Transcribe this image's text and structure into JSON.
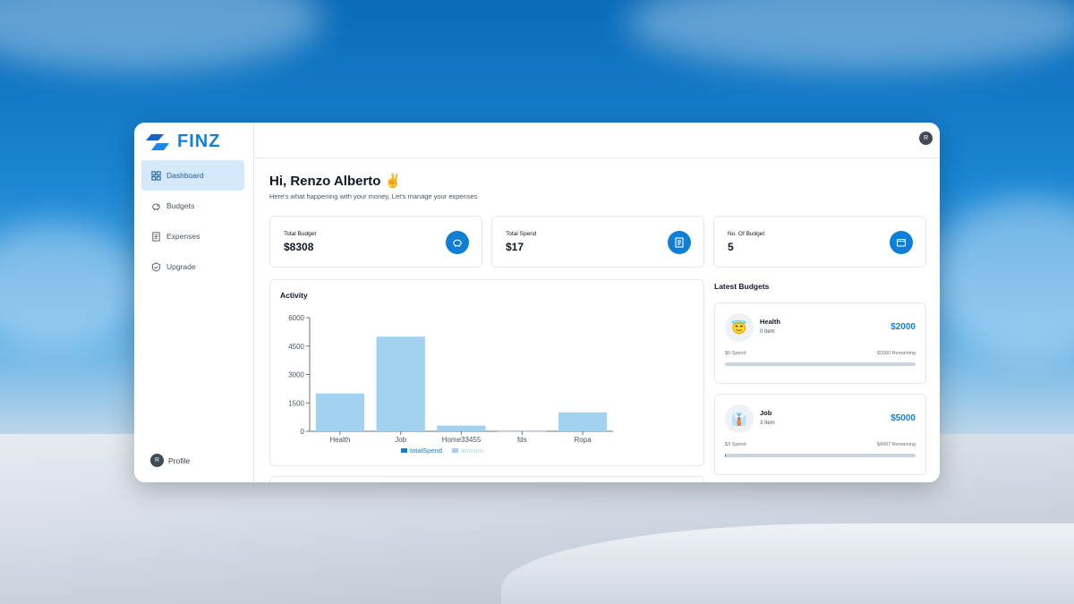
{
  "app": {
    "name": "FINZ"
  },
  "sidebar": {
    "items": [
      {
        "label": "Dashboard",
        "icon": "grid-icon",
        "active": true
      },
      {
        "label": "Budgets",
        "icon": "piggy-bank-icon",
        "active": false
      },
      {
        "label": "Expenses",
        "icon": "receipt-icon",
        "active": false
      },
      {
        "label": "Upgrade",
        "icon": "shield-check-icon",
        "active": false
      }
    ],
    "profile": {
      "initial": "R",
      "label": "Profile"
    }
  },
  "topbar": {
    "avatar_initial": "R"
  },
  "header": {
    "greeting": "Hi, Renzo Alberto ✌️",
    "subtitle": "Here's what happening with your money, Let's manage your expenses"
  },
  "cards": [
    {
      "label": "Total Budget",
      "value": "$8308",
      "icon": "piggy-bank-icon"
    },
    {
      "label": "Total Spend",
      "value": "$17",
      "icon": "receipt-icon"
    },
    {
      "label": "No. Of Budget",
      "value": "5",
      "icon": "wallet-icon"
    }
  ],
  "activity": {
    "title": "Activity"
  },
  "latest": {
    "title": "Latest Budgets",
    "budgets": [
      {
        "emoji": "😇",
        "name": "Health",
        "items": "0 Item",
        "amount": "$2000",
        "spend": "$0 Spend",
        "remaining": "$2000 Remaining",
        "progress": 0
      },
      {
        "emoji": "👔",
        "name": "Job",
        "items": "3 Item",
        "amount": "$5000",
        "spend": "$3 Spend",
        "remaining": "$4997 Remaining",
        "progress": 0.0006
      }
    ]
  },
  "colors": {
    "accent": "#0f7fd6",
    "bar_light": "#a3d2f0"
  },
  "chart_data": {
    "type": "bar",
    "title": "Activity",
    "categories": [
      "Health",
      "Job",
      "Home33455",
      "fds",
      "Ropa"
    ],
    "series": [
      {
        "name": "totalSpend",
        "values": [
          0,
          3,
          0,
          14,
          0
        ]
      },
      {
        "name": "amount",
        "values": [
          2000,
          5000,
          300,
          8,
          1000
        ]
      }
    ],
    "ylim": [
      0,
      6000
    ],
    "yticks": [
      0,
      1500,
      3000,
      4500,
      6000
    ],
    "legend": "bottom",
    "grid": false
  }
}
